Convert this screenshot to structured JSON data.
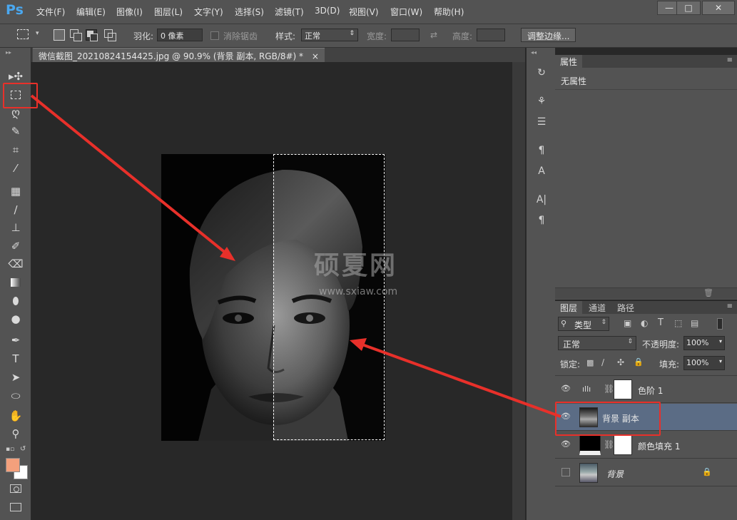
{
  "app": {
    "logo": "Ps"
  },
  "menu": [
    "文件(F)",
    "编辑(E)",
    "图像(I)",
    "图层(L)",
    "文字(Y)",
    "选择(S)",
    "滤镜(T)",
    "3D(D)",
    "视图(V)",
    "窗口(W)",
    "帮助(H)"
  ],
  "window_controls": {
    "minimize": "—",
    "maximize": "□",
    "close": "✕"
  },
  "options": {
    "feather_label": "羽化:",
    "feather_value": "0 像素",
    "antialias_label": "消除锯齿",
    "style_label": "样式:",
    "style_value": "正常",
    "width_label": "宽度:",
    "height_label": "高度:",
    "refine_edge": "调整边缘..."
  },
  "document": {
    "tab_title": "微信截图_20210824154425.jpg @ 90.9% (背景 副本, RGB/8#) *",
    "tab_close": "×",
    "watermark": "硕夏网",
    "watermark_url": "www.sxiaw.com"
  },
  "properties": {
    "tab": "属性",
    "content": "无属性"
  },
  "layers_panel": {
    "tabs": [
      "图层",
      "通道",
      "路径"
    ],
    "filter_kind": "类型",
    "blend_mode": "正常",
    "opacity_label": "不透明度:",
    "opacity_value": "100%",
    "lock_label": "锁定:",
    "fill_label": "填充:",
    "fill_value": "100%",
    "layers": [
      {
        "name": "色阶 1",
        "visible": true,
        "type": "adjustment"
      },
      {
        "name": "背景 副本",
        "visible": true,
        "type": "image",
        "selected": true
      },
      {
        "name": "颜色填充 1",
        "visible": true,
        "type": "fill"
      },
      {
        "name": "背景",
        "visible": false,
        "type": "image",
        "locked": true
      }
    ]
  },
  "colors": {
    "foreground": "#f4a07c",
    "background": "#ffffff",
    "annotation": "#e8302a",
    "selected_layer": "#5b6c85"
  }
}
